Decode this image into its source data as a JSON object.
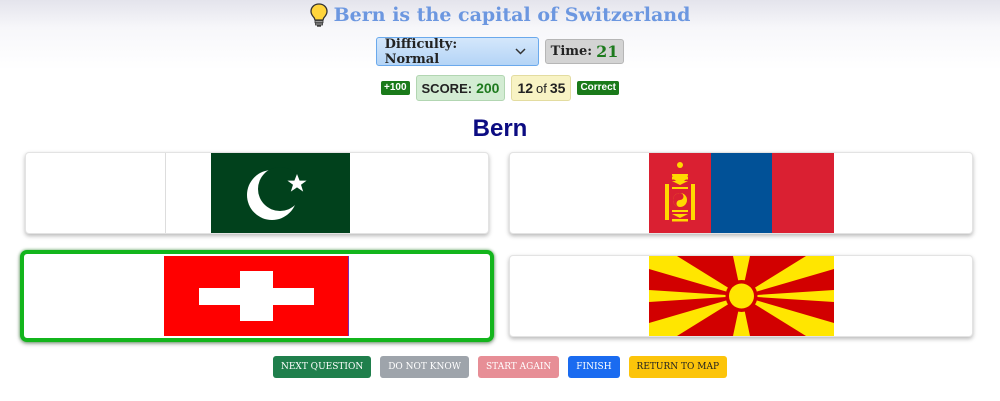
{
  "hint": {
    "text": "Bern is the capital of Switzerland",
    "icon": "lightbulb-icon"
  },
  "controls": {
    "difficulty_label": "Difficulty: Normal",
    "time_label": "Time:",
    "time_value": "21"
  },
  "stats": {
    "bonus": "+100",
    "score_label": "SCORE:",
    "score_value": "200",
    "progress_current": "12",
    "progress_of": "of",
    "progress_total": "35",
    "result": "Correct"
  },
  "question": "Bern",
  "options": [
    {
      "flag": "Pakistan",
      "selected": false
    },
    {
      "flag": "Mongolia",
      "selected": false
    },
    {
      "flag": "Switzerland",
      "selected": true
    },
    {
      "flag": "North Macedonia",
      "selected": false
    }
  ],
  "buttons": {
    "next": "NEXT QUESTION",
    "dont_know": "DO NOT KNOW",
    "start_again": "START AGAIN",
    "finish": "FINISH",
    "return_map": "RETURN TO MAP"
  },
  "colors": {
    "hint": "#6c97e0",
    "question": "#0c0c82",
    "selected_border": "#13b51c",
    "score_green": "#1e7a1e"
  }
}
